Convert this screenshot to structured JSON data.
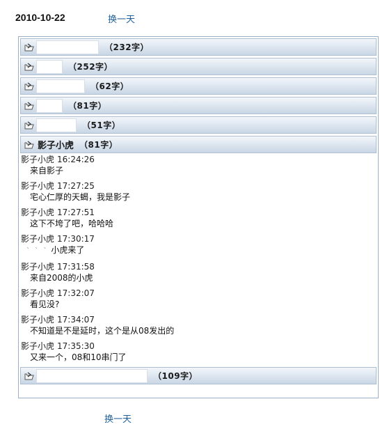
{
  "header": {
    "date": "2010-10-22",
    "nav_label": "换一天"
  },
  "footer": {
    "nav_label": "换一天"
  },
  "collapsed_top": [
    {
      "name_width": 90,
      "count": "（232字）"
    },
    {
      "name_width": 38,
      "count": "（252字）"
    },
    {
      "name_width": 70,
      "count": "（62字）"
    },
    {
      "name_width": 38,
      "count": "（81字）"
    },
    {
      "name_width": 58,
      "count": "（51字）"
    }
  ],
  "open_bar": {
    "name": "影子小虎",
    "count": "（81字）"
  },
  "messages": [
    {
      "sender": "影子小虎",
      "time": "16:24:26",
      "text": "来自影子"
    },
    {
      "sender": "影子小虎",
      "time": "17:27:25",
      "text": "宅心仁厚的天蝎，我是影子"
    },
    {
      "sender": "影子小虎",
      "time": "17:27:51",
      "text": "这下不垮了吧，哈哈哈"
    },
    {
      "sender": "影子小虎",
      "time": "17:30:17",
      "text": "小虎来了",
      "redacted_prefix": "` ` `"
    },
    {
      "sender": "影子小虎",
      "time": "17:31:58",
      "text": "来自2008的小虎"
    },
    {
      "sender": "影子小虎",
      "time": "17:32:07",
      "text": "看见没?"
    },
    {
      "sender": "影子小虎",
      "time": "17:34:07",
      "text": "不知道是不是延时，这个是从08发出的"
    },
    {
      "sender": "影子小虎",
      "time": "17:35:30",
      "text": "又来一个，08和10串门了"
    }
  ],
  "collapsed_bottom": [
    {
      "name_width": 160,
      "count": "（109字）"
    }
  ]
}
